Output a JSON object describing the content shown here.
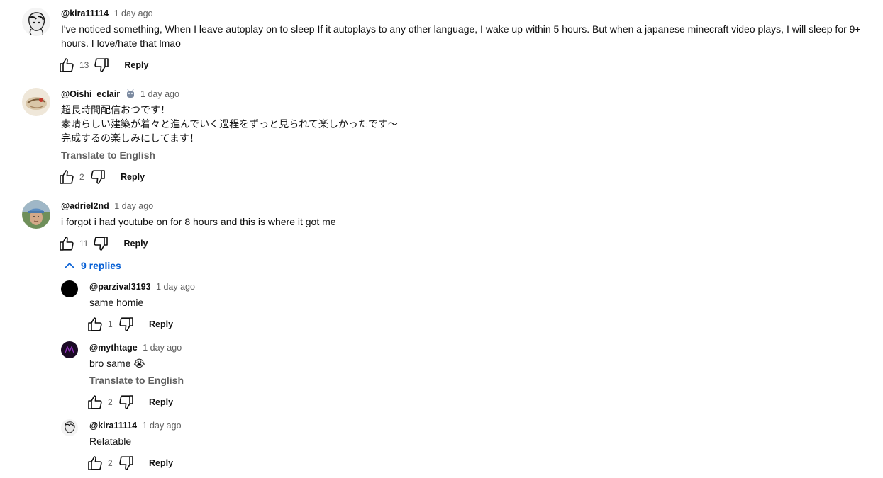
{
  "comments": [
    {
      "author": "@kira11114",
      "time": "1 day ago",
      "text_lines": [
        "I've noticed something, When I leave autoplay on to sleep If it autoplays to any other language, I wake up within 5 hours. But when a japanese minecraft video plays, I will sleep for 9+",
        "hours. I love/hate that lmao"
      ],
      "likes": "13",
      "reply_label": "Reply"
    },
    {
      "author": "@Oishi_eclair",
      "time": "1 day ago",
      "badge": "member-badge-icon",
      "text_lines": [
        "超長時間配信おつです！",
        "素晴らしい建築が着々と進んでいく過程をずっと見られて楽しかったです〜",
        "完成するの楽しみにしてます！"
      ],
      "translate_label": "Translate to English",
      "likes": "2",
      "reply_label": "Reply"
    },
    {
      "author": "@adriel2nd",
      "time": "1 day ago",
      "text_lines": [
        "i forgot i had youtube on for 8 hours and this is where it got me"
      ],
      "likes": "11",
      "reply_label": "Reply",
      "replies_toggle": "9 replies",
      "replies": [
        {
          "author": "@parzival3193",
          "time": "1 day ago",
          "text": "same homie",
          "likes": "1",
          "reply_label": "Reply"
        },
        {
          "author": "@mythtage",
          "time": "1 day ago",
          "text": "bro same 😭",
          "translate_label": "Translate to English",
          "likes": "2",
          "reply_label": "Reply"
        },
        {
          "author": "@kira11114",
          "time": "1 day ago",
          "text": "Relatable",
          "likes": "2",
          "reply_label": "Reply"
        }
      ]
    }
  ],
  "colors": {
    "link_blue": "#065fd4",
    "secondary_text": "#606060",
    "primary_text": "#0f0f0f"
  },
  "icons": [
    "thumb-up-icon",
    "thumb-down-icon",
    "chevron-up-icon",
    "member-badge-icon"
  ]
}
